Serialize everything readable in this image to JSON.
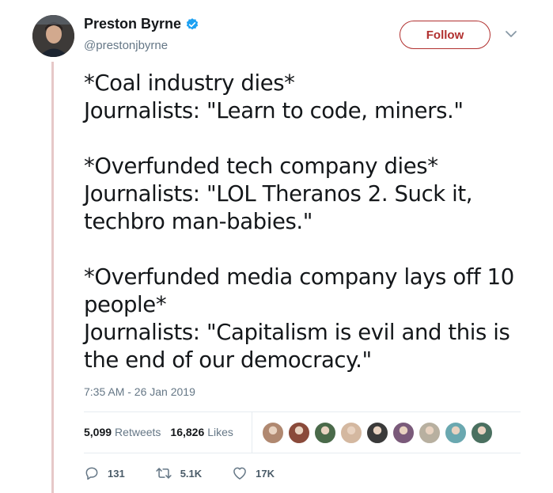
{
  "author": {
    "display_name": "Preston Byrne",
    "handle": "@prestonjbyrne",
    "verified": true
  },
  "follow_label": "Follow",
  "tweet": {
    "paragraphs": [
      [
        "*Coal industry dies*",
        "Journalists: \"Learn to code, miners.\""
      ],
      [
        "*Overfunded tech company dies*",
        "Journalists: \"LOL Theranos 2. Suck it,",
        "techbro man-babies.\""
      ],
      [
        "*Overfunded media company lays off 10",
        "people*",
        "Journalists: \"Capitalism is evil and this is",
        "the end of our democracy.\""
      ]
    ],
    "timestamp": "7:35 AM - 26 Jan 2019"
  },
  "stats": {
    "retweets_count": "5,099",
    "retweets_label": "Retweets",
    "likes_count": "16,826",
    "likes_label": "Likes"
  },
  "liker_avatar_colors": [
    "#b08870",
    "#8a4a3a",
    "#4a6a4a",
    "#d4b8a0",
    "#3a3a3a",
    "#7a5a7a",
    "#b8b0a0",
    "#6aa8b0",
    "#4a7060"
  ],
  "actions": {
    "replies": "131",
    "retweets": "5.1K",
    "likes": "17K"
  },
  "icons": {
    "verified": "verified-badge-icon",
    "caret": "chevron-down-icon",
    "reply": "reply-icon",
    "retweet": "retweet-icon",
    "like": "heart-icon"
  },
  "colors": {
    "follow_accent": "#b1302f",
    "verified_blue": "#1da1f2",
    "thread_line": "#e6c8c8"
  }
}
